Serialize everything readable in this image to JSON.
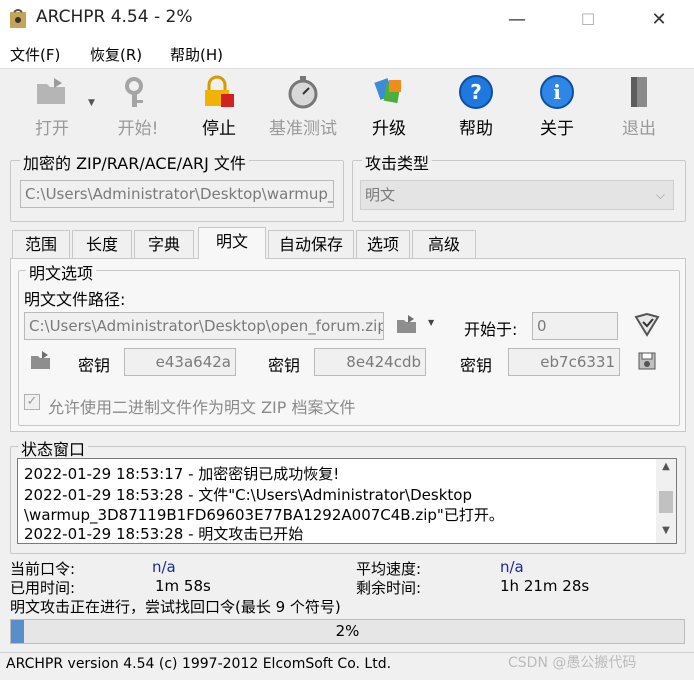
{
  "window": {
    "title": "ARCHPR 4.54 - 2%",
    "minimize": "—",
    "maximize": "☐",
    "close": "✕"
  },
  "menu": [
    {
      "label": "文件(F)"
    },
    {
      "label": "恢复(R)"
    },
    {
      "label": "帮助(H)"
    }
  ],
  "toolbar": {
    "open": "打开",
    "start": "开始!",
    "stop": "停止",
    "benchmark": "基准测试",
    "upgrade": "升级",
    "help": "帮助",
    "about": "关于",
    "exit": "退出"
  },
  "encrypted": {
    "group_label": "加密的 ZIP/RAR/ACE/ARJ 文件",
    "path": "C:\\Users\\Administrator\\Desktop\\warmup_"
  },
  "attack": {
    "group_label": "攻击类型",
    "selected": "明文"
  },
  "tabs": [
    {
      "label": "范围"
    },
    {
      "label": "长度"
    },
    {
      "label": "字典"
    },
    {
      "label": "明文"
    },
    {
      "label": "自动保存"
    },
    {
      "label": "选项"
    },
    {
      "label": "高级"
    }
  ],
  "plaintext": {
    "group_label": "明文选项",
    "path_label": "明文文件路径:",
    "path": "C:\\Users\\Administrator\\Desktop\\open_forum.zip",
    "start_at_label": "开始于:",
    "start_at": "0",
    "key_label": "密钥",
    "key1": "e43a642a",
    "key2": "8e424cdb",
    "key3": "eb7c6331",
    "allow_binary": "允许使用二进制文件作为明文 ZIP 档案文件"
  },
  "status": {
    "group_label": "状态窗口",
    "lines": [
      "2022-01-29 18:53:17 - 加密密钥已成功恢复!",
      "2022-01-29 18:53:28 - 文件\"C:\\Users\\Administrator\\Desktop",
      "\\warmup_3D87119B1FD69603E77BA1292A007C4B.zip\"已打开。",
      "2022-01-29 18:53:28 - 明文攻击已开始"
    ]
  },
  "info": {
    "current_pw_label": "当前口令:",
    "current_pw": "n/a",
    "avg_speed_label": "平均速度:",
    "avg_speed": "n/a",
    "elapsed_label": "已用时间:",
    "elapsed": "1m 58s",
    "remaining_label": "剩余时间:",
    "remaining": "1h 21m 28s",
    "message": "明文攻击正在进行，尝试找回口令(最长 9 个符号)"
  },
  "progress": {
    "value": 0.02,
    "label": "2%"
  },
  "statusbar": {
    "text": "ARCHPR version 4.54 (c) 1997-2012 ElcomSoft Co. Ltd.",
    "watermark": "CSDN @愚公搬代码"
  },
  "colors": {
    "accent": "#1a2a9a",
    "progress_fill": "#5a8ec8"
  }
}
